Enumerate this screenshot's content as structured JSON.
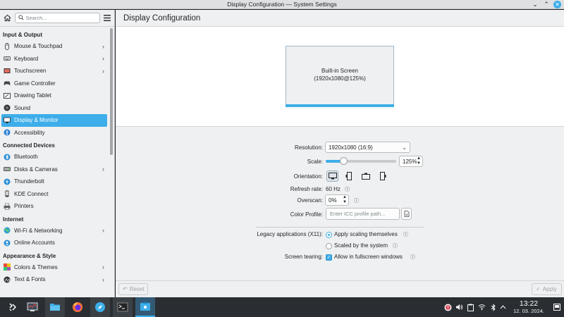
{
  "window": {
    "title": "Display Configuration — System Settings"
  },
  "sidebar": {
    "search_placeholder": "Search...",
    "sections": [
      {
        "title": "Input & Output",
        "items": [
          {
            "label": "Mouse & Touchpad",
            "icon": "mouse-icon",
            "chevron": true
          },
          {
            "label": "Keyboard",
            "icon": "keyboard-icon",
            "chevron": true
          },
          {
            "label": "Touchscreen",
            "icon": "touchscreen-icon",
            "chevron": true
          },
          {
            "label": "Game Controller",
            "icon": "gamepad-icon",
            "chevron": false
          },
          {
            "label": "Drawing Tablet",
            "icon": "tablet-icon",
            "chevron": false
          },
          {
            "label": "Sound",
            "icon": "speaker-icon",
            "chevron": false
          },
          {
            "label": "Display & Monitor",
            "icon": "monitor-icon",
            "chevron": true,
            "active": true
          },
          {
            "label": "Accessibility",
            "icon": "accessibility-icon",
            "chevron": false
          }
        ]
      },
      {
        "title": "Connected Devices",
        "items": [
          {
            "label": "Bluetooth",
            "icon": "bluetooth-icon",
            "chevron": false
          },
          {
            "label": "Disks & Cameras",
            "icon": "disk-icon",
            "chevron": true
          },
          {
            "label": "Thunderbolt",
            "icon": "thunderbolt-icon",
            "chevron": false
          },
          {
            "label": "KDE Connect",
            "icon": "phone-icon",
            "chevron": false
          },
          {
            "label": "Printers",
            "icon": "printer-icon",
            "chevron": false
          }
        ]
      },
      {
        "title": "Internet",
        "items": [
          {
            "label": "Wi-Fi & Networking",
            "icon": "network-icon",
            "chevron": true
          },
          {
            "label": "Online Accounts",
            "icon": "accounts-icon",
            "chevron": false
          }
        ]
      },
      {
        "title": "Appearance & Style",
        "items": [
          {
            "label": "Colors & Themes",
            "icon": "palette-icon",
            "chevron": true
          },
          {
            "label": "Text & Fonts",
            "icon": "fonts-icon",
            "chevron": true
          }
        ]
      }
    ]
  },
  "main": {
    "title": "Display Configuration",
    "screen": {
      "name": "Built-in Screen",
      "mode": "(1920x1080@125%)"
    },
    "resolution": {
      "label": "Resolution:",
      "value": "1920x1080 (16:9)"
    },
    "scale": {
      "label": "Scale:",
      "value": "125%",
      "fraction": 0.25
    },
    "orientation": {
      "label": "Orientation:",
      "selected": 0
    },
    "refresh_rate": {
      "label": "Refresh rate:",
      "value": "60 Hz"
    },
    "overscan": {
      "label": "Overscan:",
      "value": "0%"
    },
    "color_profile": {
      "label": "Color Profile:",
      "placeholder": "Enter ICC profile path..."
    },
    "legacy": {
      "label": "Legacy applications (X11):",
      "option1": "Apply scaling themselves",
      "option2": "Scaled by the system",
      "selected": 0
    },
    "tearing": {
      "label": "Screen tearing:",
      "option": "Allow in fullscreen windows",
      "checked": true
    },
    "reset_label": "Reset",
    "apply_label": "Apply"
  },
  "taskbar": {
    "time": "13:22",
    "date": "12. 03. 2024."
  },
  "colors": {
    "accent": "#3daee9",
    "window_bg": "#eff0f1",
    "taskbar_bg": "#2a2e32"
  }
}
